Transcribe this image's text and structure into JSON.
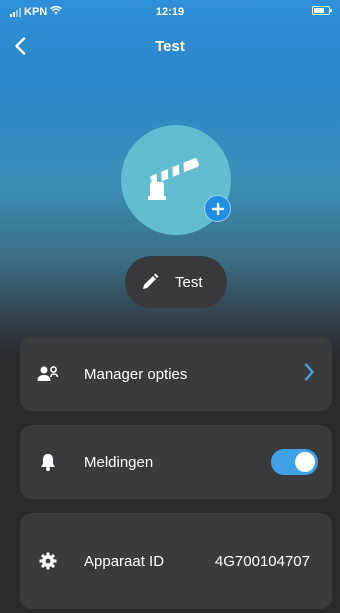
{
  "statusbar": {
    "carrier": "KPN",
    "time": "12:19"
  },
  "nav": {
    "title": "Test",
    "back_icon": "chevron-left-icon"
  },
  "device": {
    "avatar_icon": "barrier-gate-icon",
    "add_icon": "plus-icon",
    "name": "Test",
    "edit_icon": "pencil-icon"
  },
  "settings": [
    {
      "icon": "manager-users-icon",
      "label": "Manager opties",
      "control": "chevron-right-icon"
    },
    {
      "icon": "bell-icon",
      "label": "Meldingen",
      "control": "toggle",
      "toggle_on": true
    },
    {
      "icon": "gear-icon",
      "label": "Apparaat ID",
      "value": "4G700104707"
    }
  ],
  "colors": {
    "accent": "#3fa2e8",
    "avatar_bg": "#62bdd0",
    "card_bg": "#3b3b3e",
    "background": "#2a2a2d"
  }
}
